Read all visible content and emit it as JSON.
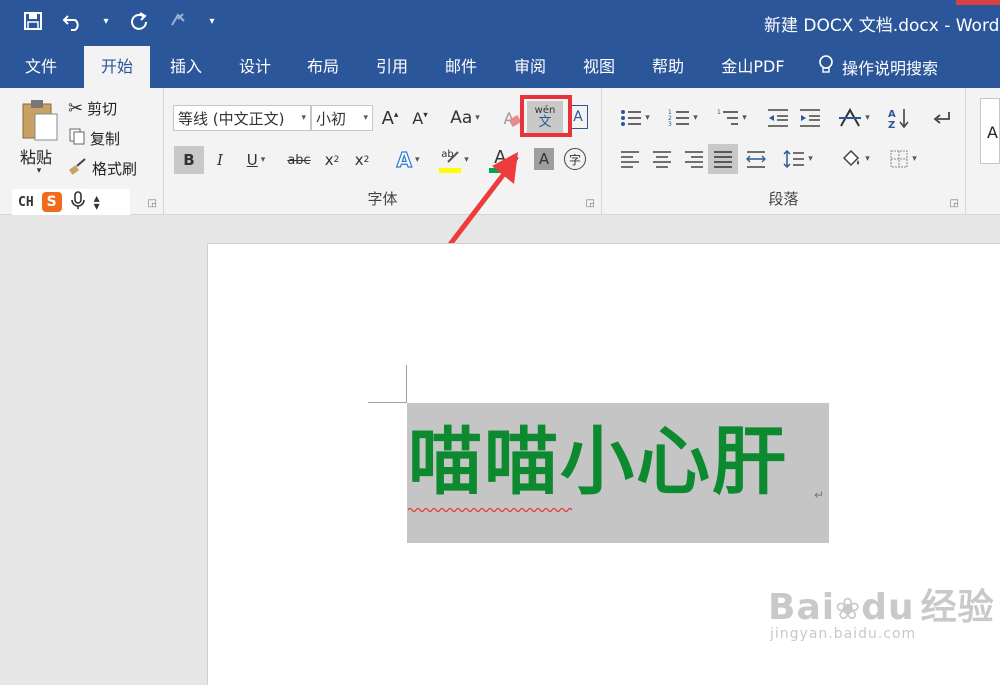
{
  "titlebar": {
    "title": "新建 DOCX 文档.docx  -  Word",
    "qat": {
      "save_icon": "save-icon",
      "undo_icon": "undo-icon",
      "redo_icon": "redo-icon",
      "touch_icon": "touch-mode-icon",
      "customize_icon": "customize-qat-icon"
    }
  },
  "tabs": {
    "items": [
      "文件",
      "开始",
      "插入",
      "设计",
      "布局",
      "引用",
      "邮件",
      "审阅",
      "视图",
      "帮助",
      "金山PDF"
    ],
    "active": "开始",
    "search_label": "操作说明搜索"
  },
  "clipboard": {
    "paste": "粘贴",
    "cut": "剪切",
    "copy": "复制",
    "format_painter": "格式刷"
  },
  "font": {
    "font_name": "等线 (中文正文)",
    "font_size": "小初",
    "change_case": "Aa",
    "phonetic_top": "wén",
    "phonetic_bottom": "文",
    "bold": "B",
    "italic": "I",
    "underline": "U",
    "strikethrough": "abc",
    "subscript": "x",
    "superscript": "x",
    "group_label": "字体",
    "accent_colors": {
      "highlight": "#ffff00",
      "font_color": "#00a550",
      "red_box": "#e8323c"
    }
  },
  "paragraph": {
    "group_label": "段落"
  },
  "styles": {
    "preview": "A"
  },
  "ime": {
    "label": "CH",
    "badge": "S"
  },
  "document": {
    "text": "喵喵小心肝",
    "text_color": "#0d8a2f",
    "para_mark": "↵"
  },
  "watermark": {
    "brand": "Bai",
    "brand2": "经验",
    "brand_du": "du",
    "url": "jingyan.baidu.com"
  }
}
